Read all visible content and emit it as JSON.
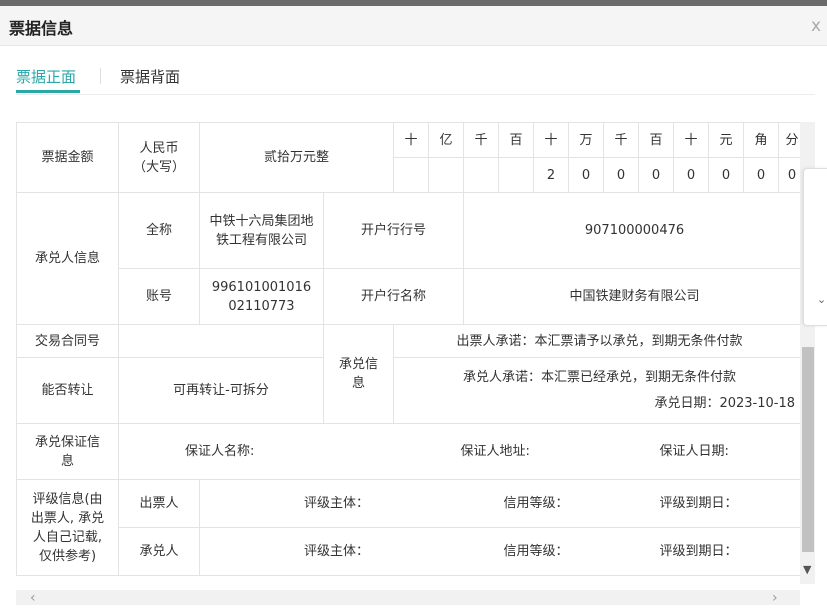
{
  "dialog": {
    "title": "票据信息",
    "close": "x"
  },
  "tabs": [
    {
      "label": "票据正面"
    },
    {
      "label": "票据背面"
    }
  ],
  "amount": {
    "label": "票据金额",
    "currency": "人民币（大写）",
    "words": "贰拾万元整",
    "units": [
      "十",
      "亿",
      "千",
      "百",
      "十",
      "万",
      "千",
      "百",
      "十",
      "元",
      "角",
      "分"
    ],
    "digits": [
      "",
      "",
      "",
      "",
      "2",
      "0",
      "0",
      "0",
      "0",
      "0",
      "0",
      "0"
    ]
  },
  "acceptor": {
    "label": "承兑人信息",
    "fullname_label": "全称",
    "fullname": "中铁十六局集团地铁工程有限公司",
    "bank_no_label": "开户行行号",
    "bank_no": "907100000476",
    "account_label": "账号",
    "account": "99610100101602110773",
    "bank_name_label": "开户行名称",
    "bank_name": "中国铁建财务有限公司"
  },
  "contract": {
    "label": "交易合同号",
    "value": ""
  },
  "transfer": {
    "label": "能否转让",
    "value": "可再转让-可拆分"
  },
  "acceptance": {
    "label": "承兑信息",
    "drawer_promise": "出票人承诺：本汇票请予以承兑，到期无条件付款",
    "acceptor_promise": "承兑人承诺：本汇票已经承兑，到期无条件付款",
    "date": "承兑日期：2023-10-18"
  },
  "guarantee": {
    "label": "承兑保证信息",
    "name": "保证人名称:",
    "address": "保证人地址:",
    "date": "保证人日期:"
  },
  "rating": {
    "label": "评级信息(由出票人, 承兑人自己记载, 仅供参考)",
    "rows": [
      {
        "party": "出票人",
        "subject": "评级主体：",
        "level": "信用等级：",
        "expiry": "评级到期日："
      },
      {
        "party": "承兑人",
        "subject": "评级主体：",
        "level": "信用等级：",
        "expiry": "评级到期日："
      }
    ]
  }
}
